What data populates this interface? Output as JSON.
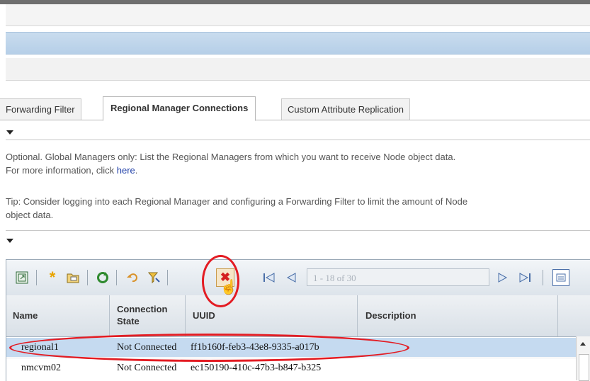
{
  "tabs": [
    "Forwarding Filter",
    "Regional Manager Connections",
    "Custom Attribute Replication"
  ],
  "description": {
    "line1": "Optional. Global Managers only: List the Regional Managers from which you want to receive Node object data.",
    "line2_prefix": "For more information, click ",
    "link": "here",
    "line2_suffix": ".",
    "tip_line1": "Tip: Consider logging into each Regional Manager and configuring a Forwarding Filter to limit the amount of Node",
    "tip_line2": "object data."
  },
  "toolbar": {
    "pager_text": "1 - 18 of 30",
    "icons": [
      "open-icon",
      "new-icon",
      "open-folder-icon",
      "refresh-icon",
      "undo-icon",
      "filter-icon",
      "delete-icon",
      "first-page-icon",
      "previous-page-icon",
      "next-page-icon",
      "last-page-icon",
      "column-chooser-icon"
    ]
  },
  "table": {
    "columns": [
      "Name",
      "Connection State",
      "UUID",
      "Description"
    ],
    "rows": [
      {
        "name": "regional1",
        "state": "Not Connected",
        "uuid": "ff1b160f-feb3-43e8-9335-a017b",
        "description": ""
      },
      {
        "name": "nmcvm02",
        "state": "Not Connected",
        "uuid": "ec150190-410c-47b3-b847-b325",
        "description": ""
      }
    ]
  },
  "colors": {
    "highlight": "#e31c23",
    "selected_row": "#c5daf0",
    "link": "#1f3fa8"
  }
}
